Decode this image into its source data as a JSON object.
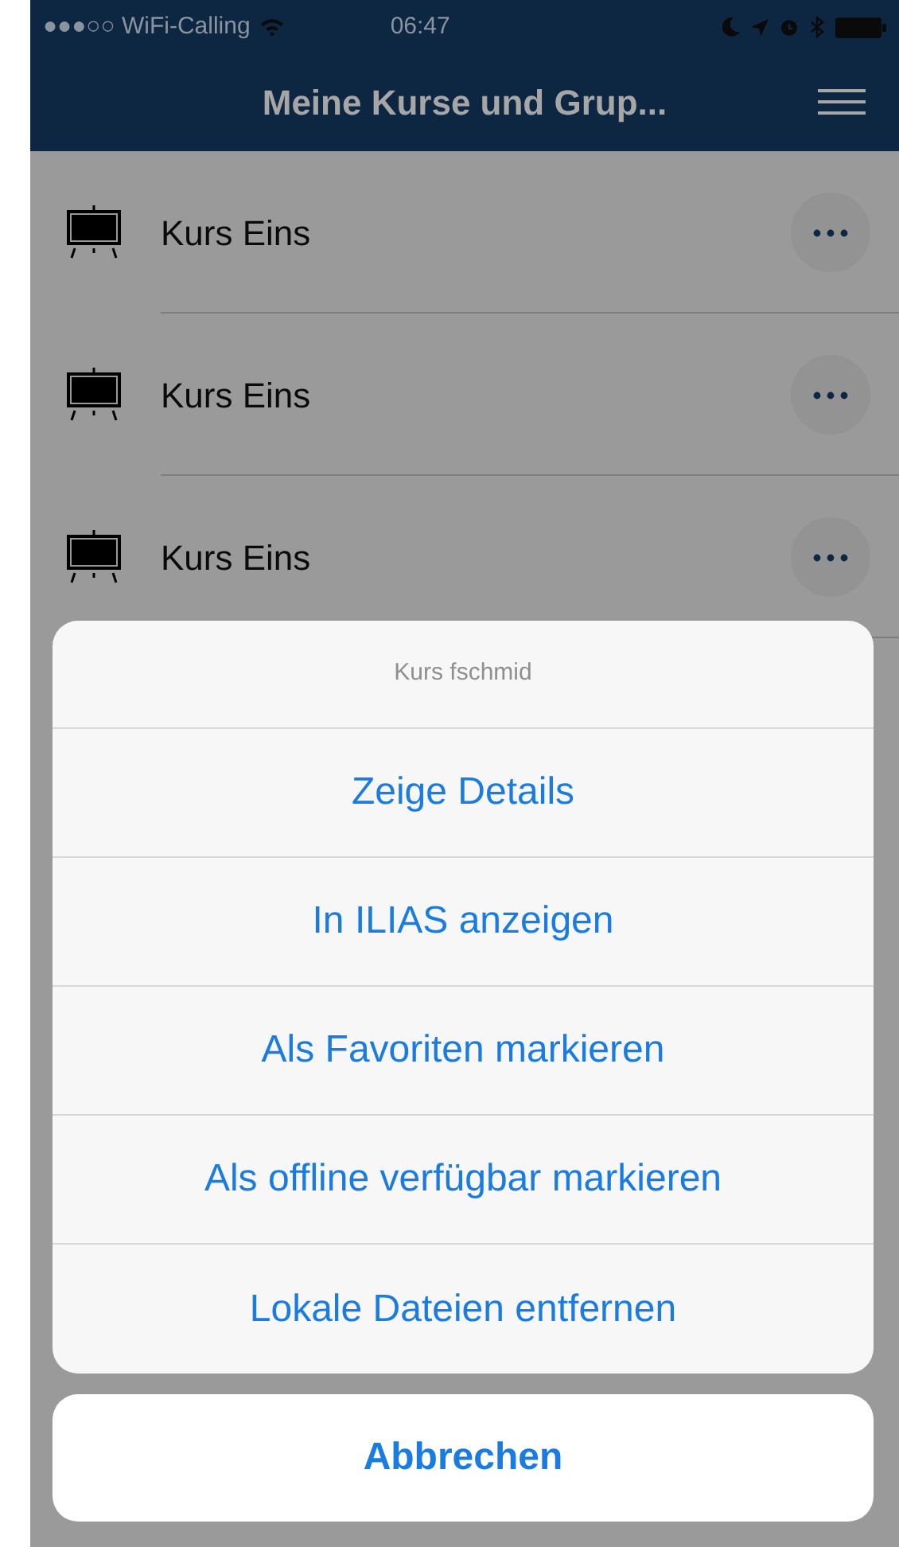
{
  "status_bar": {
    "carrier": "●●●○○ WiFi-Calling",
    "time": "06:47"
  },
  "nav_bar": {
    "title": "Meine Kurse und Grup..."
  },
  "list": [
    {
      "title": "Kurs Eins"
    },
    {
      "title": "Kurs Eins"
    },
    {
      "title": "Kurs Eins"
    }
  ],
  "action_sheet": {
    "title": "Kurs fschmid",
    "actions": [
      "Zeige Details",
      "In ILIAS anzeigen",
      "Als Favoriten markieren",
      "Als offline verfügbar markieren",
      "Lokale Dateien entfernen"
    ],
    "cancel": "Abbrechen"
  }
}
